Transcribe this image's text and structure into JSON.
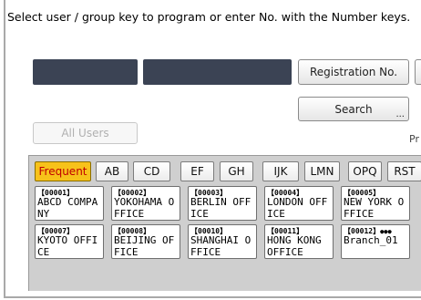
{
  "instruction": "Select user / group key to program or enter No. with the Number keys.",
  "buttons": {
    "registration_no": "Registration No.",
    "search": "Search",
    "search_ellipsis": "...",
    "all_users": "All Users"
  },
  "side_text": "Pr",
  "tabs": [
    "Frequent",
    "AB",
    "CD",
    "EF",
    "GH",
    "IJK",
    "LMN",
    "OPQ",
    "RST"
  ],
  "active_tab": "Frequent",
  "keys": [
    {
      "number": "【00001】",
      "name": "ABCD COMPANY",
      "group": false
    },
    {
      "number": "【00002】",
      "name": "YOKOHAMA OFFICE",
      "group": false
    },
    {
      "number": "【00003】",
      "name": "BERLIN OFFICE",
      "group": false
    },
    {
      "number": "【00004】",
      "name": "LONDON OFFICE",
      "group": false
    },
    {
      "number": "【00005】",
      "name": "NEW YORK OFFICE",
      "group": false
    },
    {
      "number": "【00007】",
      "name": "KYOTO OFFICE",
      "group": false
    },
    {
      "number": "【00008】",
      "name": "BEIJING OFFICE",
      "group": false
    },
    {
      "number": "【00010】",
      "name": "SHANGHAI OFFICE",
      "group": false
    },
    {
      "number": "【00011】",
      "name": "HONG KONG OFFICE",
      "group": false
    },
    {
      "number": "【00012】",
      "name": "Branch_01",
      "group": true
    }
  ],
  "icons": {
    "group": "group-icon"
  },
  "colors": {
    "active_tab": "#f7c21a",
    "active_tab_text": "#c00000",
    "dark_field": "#3b4354",
    "panel": "#cfcfcf"
  }
}
